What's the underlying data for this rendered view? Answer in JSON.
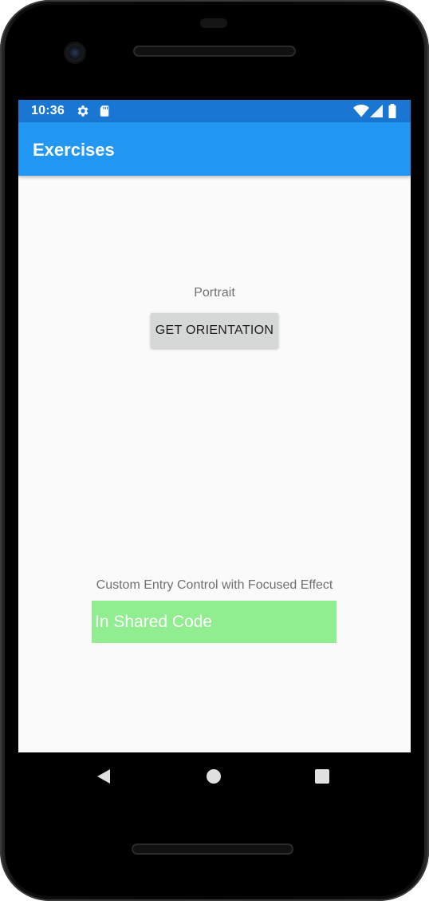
{
  "status_bar": {
    "time": "10:36",
    "left_icons": [
      "gear-icon",
      "sd-card-icon"
    ],
    "right_icons": [
      "wifi-icon",
      "signal-icon",
      "battery-icon"
    ]
  },
  "app_bar": {
    "title": "Exercises"
  },
  "main": {
    "orientation_label": "Portrait",
    "get_orientation_button": "GET ORIENTATION",
    "entry_label": "Custom Entry Control with Focused Effect",
    "entry_value": "In Shared Code"
  },
  "nav_bar": {
    "buttons": [
      "back-icon",
      "home-icon",
      "recents-icon"
    ]
  },
  "colors": {
    "status_bar": "#1976d2",
    "app_bar": "#2196f3",
    "entry_background": "#90ee90",
    "button_background": "#d6d7d7"
  }
}
